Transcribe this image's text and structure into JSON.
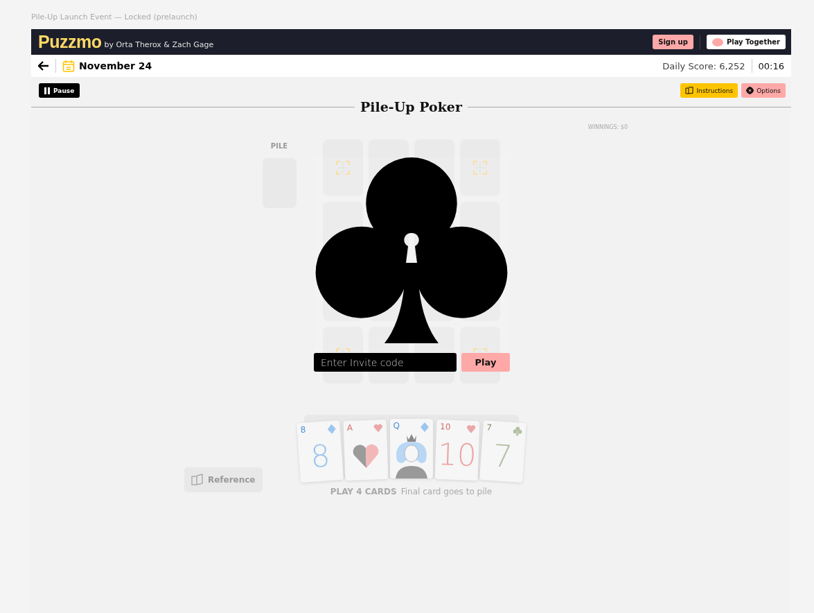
{
  "caption": "Pile-Up Launch Event — Locked (prelaunch)",
  "header": {
    "logo": "Puzzmo",
    "byline": "by Orta Therox & Zach Gage",
    "buttons": [
      {
        "label": "Sign up",
        "kind": "signup"
      },
      {
        "label": "Play Together",
        "kind": "together"
      }
    ]
  },
  "date_bar": {
    "date": "November 24",
    "score": "Daily Score: 6,252",
    "timer": "00:16"
  },
  "toolbar": {
    "pause": "Pause",
    "buttons": [
      {
        "label": "Instructions",
        "kind": "instructions"
      },
      {
        "label": "Options",
        "kind": "options"
      }
    ]
  },
  "title": "Pile-Up Poker",
  "winnings": "WINNINGS: $0",
  "pile": {
    "label": "PILE"
  },
  "grid": [
    [
      {
        "kind": "target"
      },
      {
        "kind": "blank"
      },
      {
        "kind": "blank"
      },
      {
        "kind": "target"
      }
    ],
    [
      {
        "kind": "blank"
      },
      {
        "kind": "blank"
      },
      {
        "kind": "blank"
      },
      {
        "kind": "blank"
      }
    ],
    [
      {
        "kind": "blank"
      },
      {
        "kind": "blank"
      },
      {
        "kind": "blank"
      },
      {
        "kind": "blank"
      }
    ],
    [
      {
        "kind": "target"
      },
      {
        "kind": "blank"
      },
      {
        "kind": "blank"
      },
      {
        "kind": "target"
      }
    ]
  ],
  "hand": [
    {
      "rank": "8",
      "suit": {
        "kind": "diamond"
      },
      "kind": "number",
      "center": "8"
    },
    {
      "rank": "A",
      "suit": {
        "kind": "heart"
      },
      "kind": "ace"
    },
    {
      "rank": "Q",
      "suit": {
        "kind": "diamond"
      },
      "kind": "queen"
    },
    {
      "rank": "10",
      "suit": {
        "kind": "heart"
      },
      "kind": "number",
      "center": "10"
    },
    {
      "rank": "7",
      "suit": {
        "kind": "club"
      },
      "kind": "number",
      "center": "7"
    }
  ],
  "instruction": {
    "bold": "PLAY 4 CARDS",
    "text": "Final card goes to pile"
  },
  "reference": "Reference",
  "lock": {
    "placeholder": "Enter Invite code",
    "button": "Play"
  }
}
